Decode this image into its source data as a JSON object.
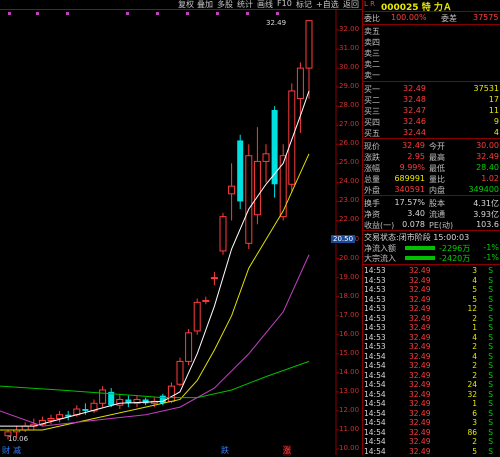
{
  "toolbar": {
    "items": [
      "复权",
      "叠加",
      "多股",
      "统计",
      "画线",
      "F10",
      "标记",
      "+自选",
      "返回"
    ]
  },
  "chart": {
    "high_label": "32.49",
    "low_label": "10.06",
    "y_ticks": [
      "32.00",
      "31.00",
      "30.00",
      "29.00",
      "28.00",
      "27.00",
      "26.00",
      "25.00",
      "24.00",
      "23.00",
      "22.00",
      "21.00",
      "20.00",
      "19.00",
      "18.00",
      "17.00",
      "16.00",
      "15.00",
      "14.00",
      "13.00",
      "12.00",
      "11.00",
      "10.00"
    ],
    "current_price_label": "20.50",
    "bottom_labels": {
      "left1": "财",
      "left2": "减",
      "mid": "跌",
      "right": "涨"
    },
    "colors": {
      "up": "#ff3c3c",
      "down": "#00e0e0",
      "ma5": "#ffffff",
      "ma10": "#e0e000",
      "ma20": "#c040c0",
      "ma60": "#00c000"
    }
  },
  "stock": {
    "code_title": "000025 特 力Ａ",
    "prefix": "L R"
  },
  "quote": {
    "weibi_label": "委比",
    "weibi_value": "100.00%",
    "weicha_label": "委差",
    "weicha_value": "37575",
    "sell_levels": [
      {
        "label": "卖五",
        "price": "",
        "vol": ""
      },
      {
        "label": "卖四",
        "price": "",
        "vol": ""
      },
      {
        "label": "卖三",
        "price": "",
        "vol": ""
      },
      {
        "label": "卖二",
        "price": "",
        "vol": ""
      },
      {
        "label": "卖一",
        "price": "",
        "vol": ""
      }
    ],
    "buy_levels": [
      {
        "label": "买一",
        "price": "32.49",
        "vol": "37531"
      },
      {
        "label": "买二",
        "price": "32.48",
        "vol": "17"
      },
      {
        "label": "买三",
        "price": "32.47",
        "vol": "11"
      },
      {
        "label": "买四",
        "price": "32.46",
        "vol": "9"
      },
      {
        "label": "买五",
        "price": "32.44",
        "vol": "4"
      }
    ],
    "stats": [
      {
        "l1": "现价",
        "v1": "32.49",
        "c1": "red",
        "l2": "今开",
        "v2": "30.00",
        "c2": "red"
      },
      {
        "l1": "涨跌",
        "v1": "2.95",
        "c1": "red",
        "l2": "最高",
        "v2": "32.49",
        "c2": "red"
      },
      {
        "l1": "涨幅",
        "v1": "9.99%",
        "c1": "red",
        "l2": "最低",
        "v2": "28.40",
        "c2": "green"
      },
      {
        "l1": "总量",
        "v1": "689991",
        "c1": "yellow",
        "l2": "量比",
        "v2": "1.02",
        "c2": "red"
      },
      {
        "l1": "外盘",
        "v1": "340591",
        "c1": "red",
        "l2": "内盘",
        "v2": "349400",
        "c2": "green"
      }
    ],
    "stats2": [
      {
        "l1": "换手",
        "v1": "17.57%",
        "l2": "股本",
        "v2": "4.31亿"
      },
      {
        "l1": "净资",
        "v1": "3.40",
        "l2": "流通",
        "v2": "3.93亿"
      },
      {
        "l1": "收益(一)",
        "v1": "0.078",
        "l2": "PE(动)",
        "v2": "103.6"
      }
    ],
    "trade_status": "交易状态:闭市阶段 15:00:03",
    "flows": [
      {
        "label": "净流入额",
        "value": "-2296万",
        "pct": "-1%"
      },
      {
        "label": "大宗流入",
        "value": "-2420万",
        "pct": "-1%"
      }
    ]
  },
  "ticks": [
    {
      "t": "14:53",
      "p": "32.49",
      "v": "3",
      "d": "S"
    },
    {
      "t": "14:53",
      "p": "32.49",
      "v": "4",
      "d": "S"
    },
    {
      "t": "14:53",
      "p": "32.49",
      "v": "5",
      "d": "S"
    },
    {
      "t": "14:53",
      "p": "32.49",
      "v": "5",
      "d": "S"
    },
    {
      "t": "14:53",
      "p": "32.49",
      "v": "12",
      "d": "S"
    },
    {
      "t": "14:53",
      "p": "32.49",
      "v": "2",
      "d": "S"
    },
    {
      "t": "14:53",
      "p": "32.49",
      "v": "1",
      "d": "S"
    },
    {
      "t": "14:53",
      "p": "32.49",
      "v": "4",
      "d": "S"
    },
    {
      "t": "14:53",
      "p": "32.49",
      "v": "2",
      "d": "S"
    },
    {
      "t": "14:54",
      "p": "32.49",
      "v": "4",
      "d": "S"
    },
    {
      "t": "14:54",
      "p": "32.49",
      "v": "2",
      "d": "S"
    },
    {
      "t": "14:54",
      "p": "32.49",
      "v": "2",
      "d": "S"
    },
    {
      "t": "14:54",
      "p": "32.49",
      "v": "24",
      "d": "S"
    },
    {
      "t": "14:54",
      "p": "32.49",
      "v": "32",
      "d": "S"
    },
    {
      "t": "14:54",
      "p": "32.49",
      "v": "1",
      "d": "S"
    },
    {
      "t": "14:54",
      "p": "32.49",
      "v": "6",
      "d": "S"
    },
    {
      "t": "14:54",
      "p": "32.49",
      "v": "3",
      "d": "S"
    },
    {
      "t": "14:54",
      "p": "32.49",
      "v": "86",
      "d": "S"
    },
    {
      "t": "14:54",
      "p": "32.49",
      "v": "2",
      "d": "S"
    },
    {
      "t": "14:54",
      "p": "32.49",
      "v": "5",
      "d": "S"
    }
  ]
}
